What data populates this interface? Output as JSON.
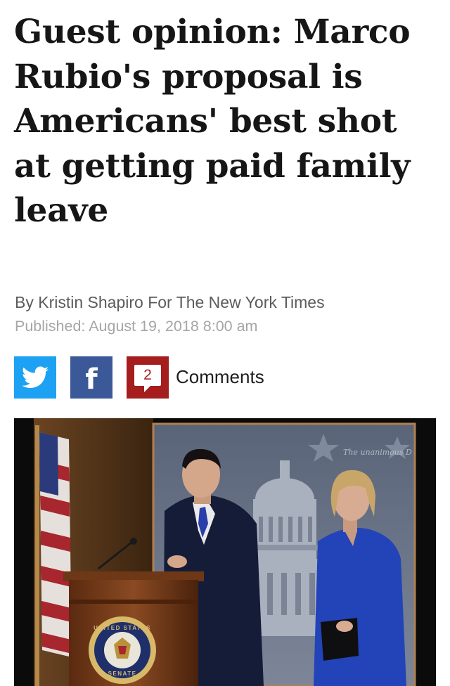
{
  "article": {
    "headline": "Guest opinion: Marco Rubio's proposal is Americans' best shot at getting paid family leave",
    "byline": "By Kristin Shapiro For The New York Times",
    "published": "Published: August 19, 2018 8:00 am"
  },
  "share": {
    "twitter_icon": "twitter-bird-icon",
    "facebook_icon": "facebook-f-icon",
    "comments_icon": "comment-bubble-icon",
    "comment_count": "2",
    "comments_label": "Comments"
  },
  "photo": {
    "backdrop_text": "The unanimous D",
    "seal_top_text": "UNITED STATES",
    "seal_bottom_text": "SENATE"
  },
  "colors": {
    "twitter": "#1da1f2",
    "facebook": "#3b5998",
    "comments": "#a51d1d"
  }
}
